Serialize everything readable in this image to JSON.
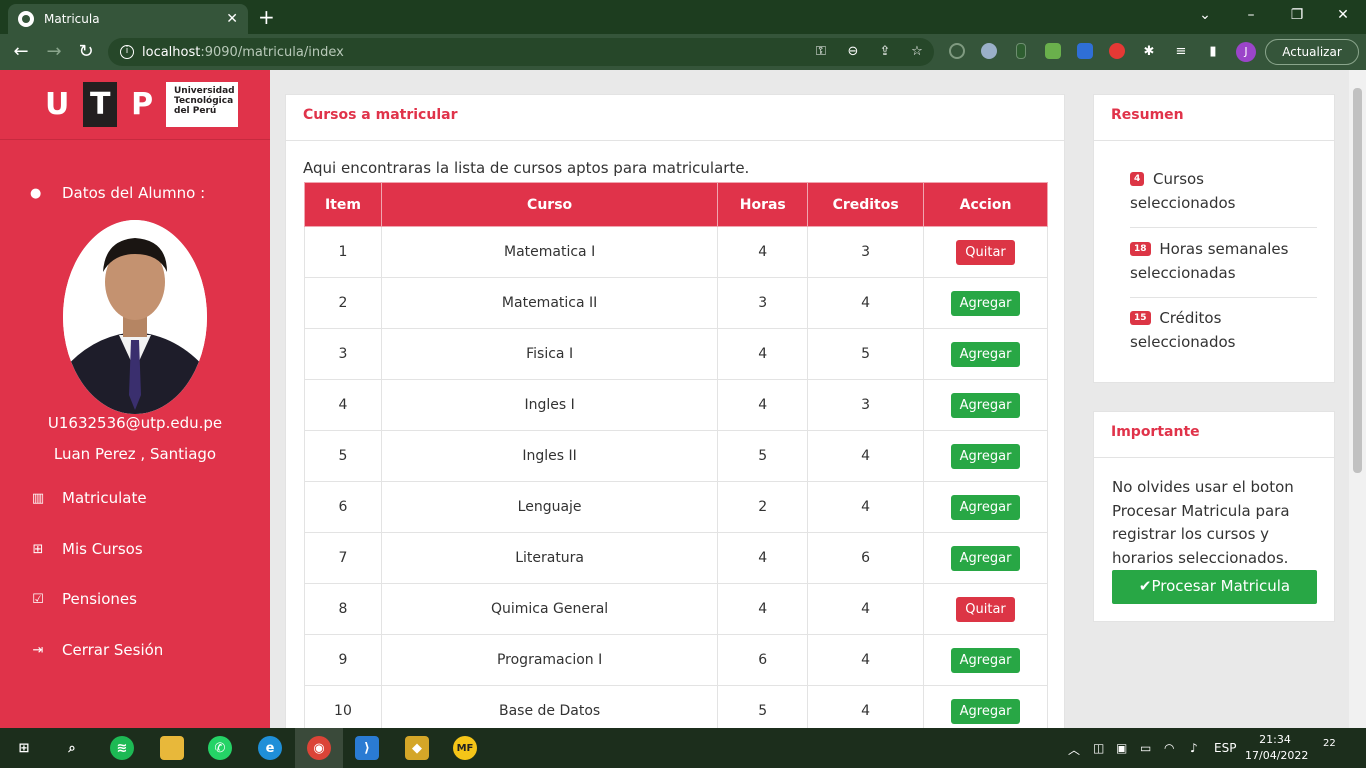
{
  "browser": {
    "tab_title": "Matricula",
    "tab_close": "✕",
    "new_tab": "+",
    "url_host": "localhost",
    "url_rest": ":9090/matricula/index",
    "update_label": "Actualizar",
    "profile_initial": "J"
  },
  "sidebar": {
    "logo_letters": [
      "U",
      "T",
      "P"
    ],
    "logo_name_lines": [
      "Universidad",
      "Tecnológica",
      "del Perú"
    ],
    "section_title": "Datos del Alumno :",
    "email": "U1632536@utp.edu.pe",
    "fullname": "Luan Perez , Santiago",
    "nav": [
      {
        "label": "Matriculate",
        "icon": "bar-chart-icon"
      },
      {
        "label": "Mis Cursos",
        "icon": "table-icon"
      },
      {
        "label": "Pensiones",
        "icon": "checkbox-icon"
      },
      {
        "label": "Cerrar Sesión",
        "icon": "sign-out-icon"
      }
    ]
  },
  "courses_card": {
    "title": "Cursos a matricular",
    "intro": "Aqui encontraras la lista de cursos aptos para matricularte.",
    "columns": [
      "Item",
      "Curso",
      "Horas",
      "Creditos",
      "Accion"
    ],
    "rows": [
      {
        "item": "1",
        "curso": "Matematica I",
        "horas": "4",
        "creditos": "3",
        "accion": "Quitar"
      },
      {
        "item": "2",
        "curso": "Matematica II",
        "horas": "3",
        "creditos": "4",
        "accion": "Agregar"
      },
      {
        "item": "3",
        "curso": "Fisica I",
        "horas": "4",
        "creditos": "5",
        "accion": "Agregar"
      },
      {
        "item": "4",
        "curso": "Ingles I",
        "horas": "4",
        "creditos": "3",
        "accion": "Agregar"
      },
      {
        "item": "5",
        "curso": "Ingles II",
        "horas": "5",
        "creditos": "4",
        "accion": "Agregar"
      },
      {
        "item": "6",
        "curso": "Lenguaje",
        "horas": "2",
        "creditos": "4",
        "accion": "Agregar"
      },
      {
        "item": "7",
        "curso": "Literatura",
        "horas": "4",
        "creditos": "6",
        "accion": "Agregar"
      },
      {
        "item": "8",
        "curso": "Quimica General",
        "horas": "4",
        "creditos": "4",
        "accion": "Quitar"
      },
      {
        "item": "9",
        "curso": "Programacion I",
        "horas": "6",
        "creditos": "4",
        "accion": "Agregar"
      },
      {
        "item": "10",
        "curso": "Base de Datos",
        "horas": "5",
        "creditos": "4",
        "accion": "Agregar"
      }
    ]
  },
  "resumen": {
    "title": "Resumen",
    "items": [
      {
        "badge": "4",
        "text_a": "Cursos",
        "text_b": "seleccionados"
      },
      {
        "badge": "18",
        "text_a": "Horas semanales",
        "text_b": "seleccionadas"
      },
      {
        "badge": "15",
        "text_a": "Créditos",
        "text_b": "seleccionados"
      }
    ]
  },
  "importante": {
    "title": "Importante",
    "text": "No olvides usar el boton Procesar Matricula para registrar los cursos y horarios seleccionados.",
    "button": "✔Procesar Matricula"
  },
  "taskbar": {
    "lang": "ESP",
    "time": "21:34",
    "date": "17/04/2022",
    "notifications": "22"
  },
  "colors": {
    "brand": "#e0334a",
    "success": "#28a745",
    "danger": "#dc3545"
  }
}
